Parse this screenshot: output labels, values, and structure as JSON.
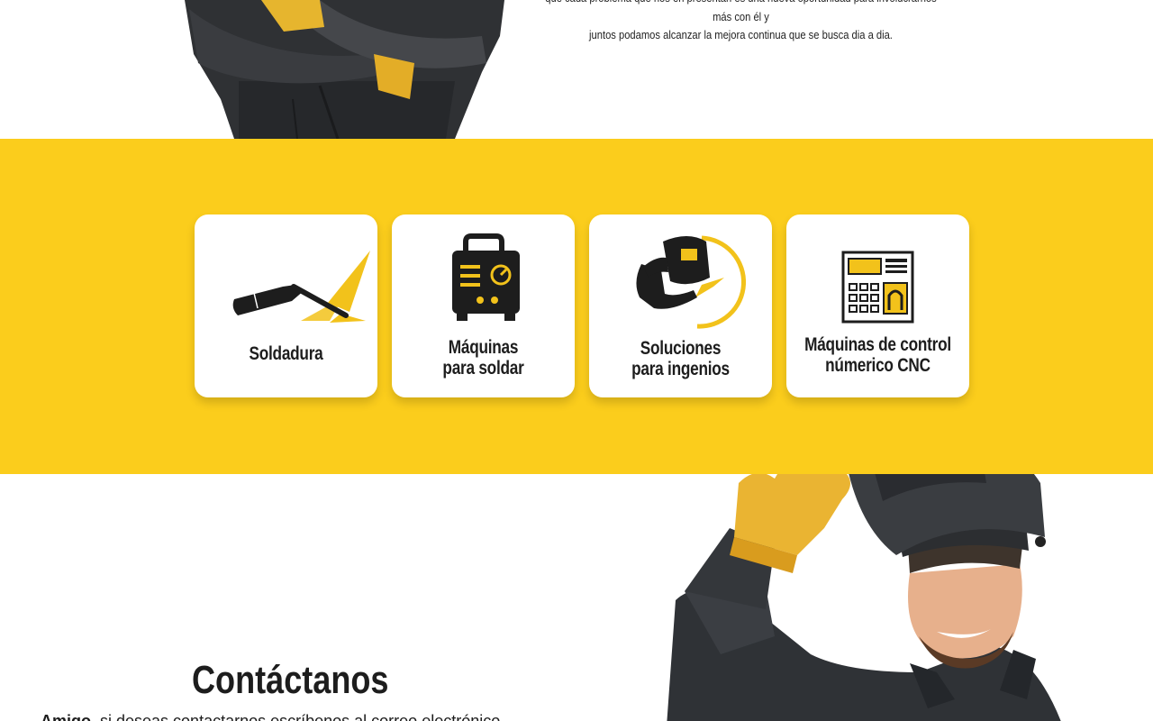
{
  "about": {
    "line1": "que cada problema que nos en presentan es una nueva oportunidad para involucrarnos más con él y",
    "line2": "juntos podamos alcanzar la mejora continua que se busca dia a dia."
  },
  "colors": {
    "accent_yellow": "#fbcd1c",
    "dark": "#1d1d1d",
    "white": "#ffffff"
  },
  "services": [
    {
      "icon": "welding-torch-icon",
      "line1": "Soldadura",
      "line2": ""
    },
    {
      "icon": "welding-machine-icon",
      "line1": "Máquinas",
      "line2": "para soldar"
    },
    {
      "icon": "welder-helmet-icon",
      "line1": "Soluciones",
      "line2": "para ingenios"
    },
    {
      "icon": "cnc-control-panel-icon",
      "line1": "Máquinas de control",
      "line2": "númerico CNC"
    }
  ],
  "contact": {
    "title": "Contáctanos",
    "lead_bold": "Amigo,",
    "lead_text": " si deseas contactarnos escríbenos al correo electrónico"
  }
}
